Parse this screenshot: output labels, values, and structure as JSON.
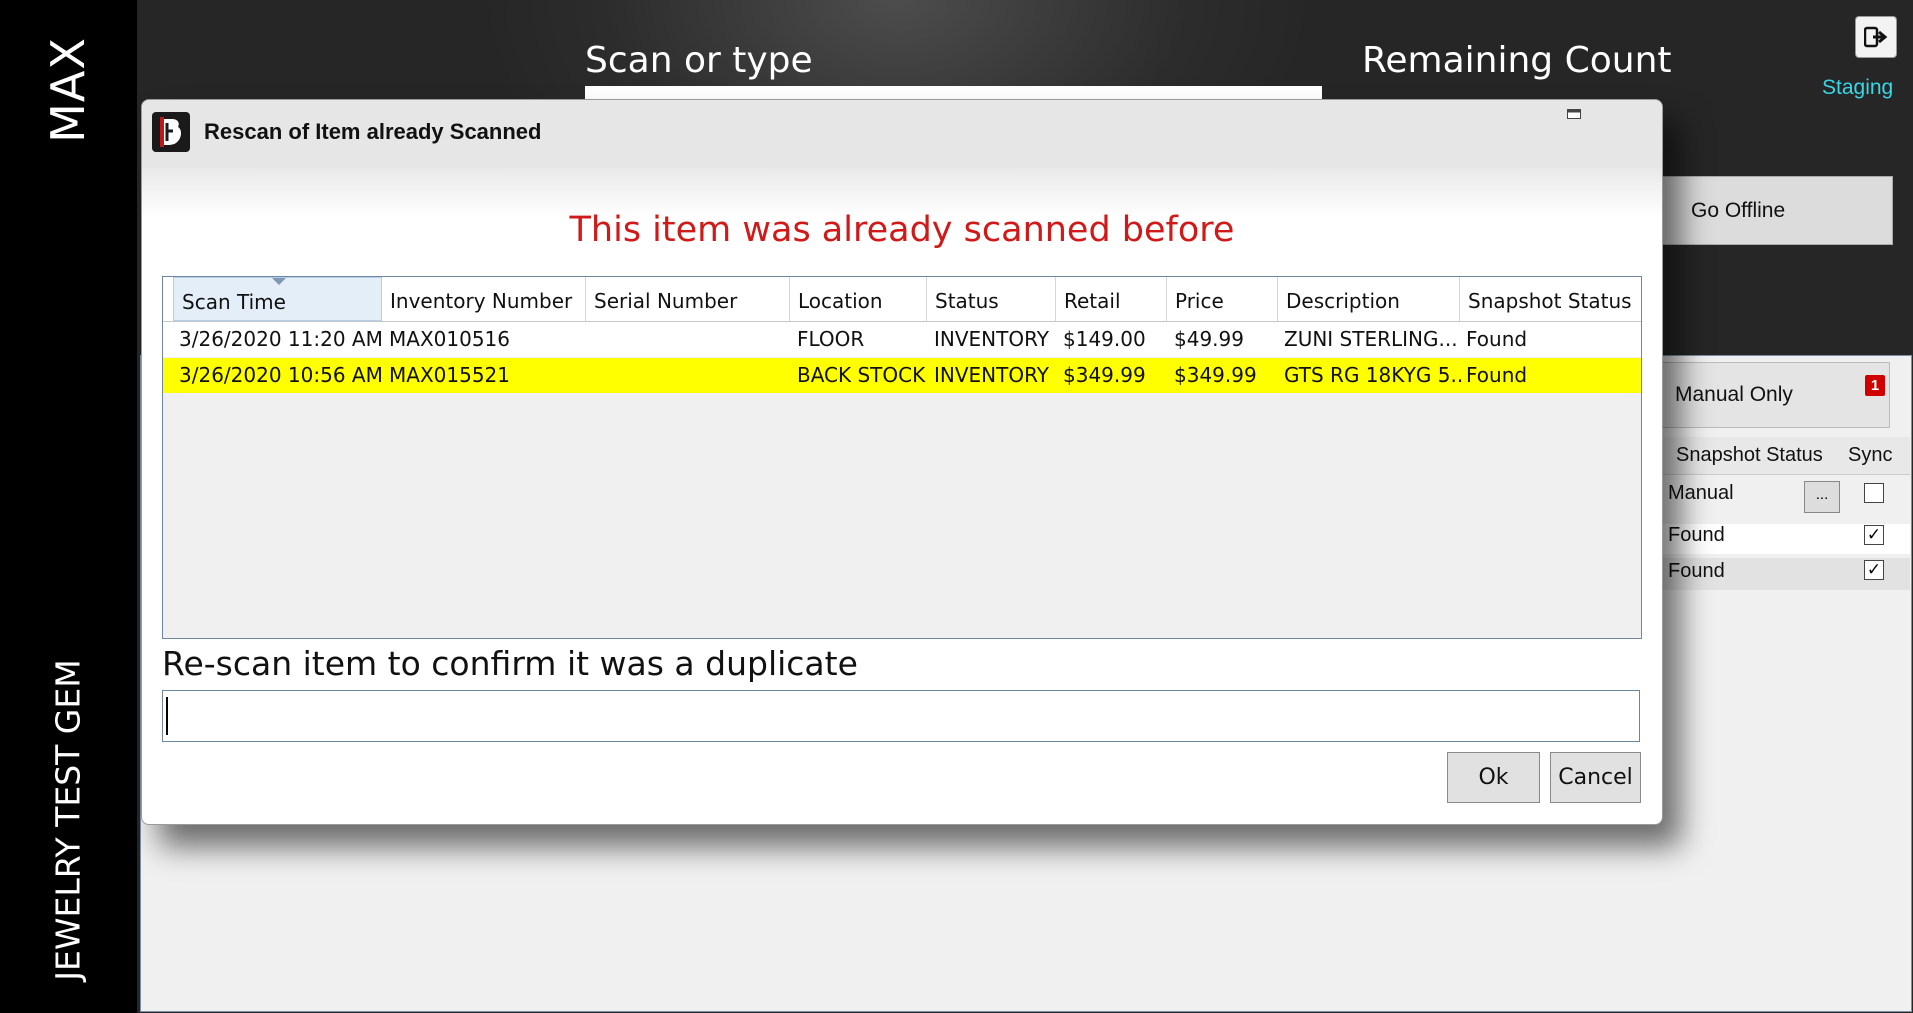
{
  "sidebar": {
    "store_name": "MAX",
    "company_name": "JEWELRY TEST GEM"
  },
  "background": {
    "scan_label": "Scan or type",
    "remaining_label": "Remaining Count",
    "staging_label": "Staging",
    "go_offline_label": "Go Offline",
    "manual_only_label": "Manual Only",
    "manual_only_badge": "1",
    "grid": {
      "headers": [
        "Snapshot Status",
        "Sync"
      ],
      "rows": [
        {
          "status": "Manual",
          "sync": false,
          "has_button": true,
          "button_label": "..."
        },
        {
          "status": "Found",
          "sync": true
        },
        {
          "status": "Found",
          "sync": true
        }
      ]
    },
    "exit_icon": "exit-icon"
  },
  "dialog": {
    "title": "Rescan of Item already Scanned",
    "headline": "This item was already scanned before",
    "headline_color": "#d01a1a",
    "table": {
      "columns": [
        "Scan Time",
        "Inventory Number",
        "Serial Number",
        "Location",
        "Status",
        "Retail",
        "Price",
        "Description",
        "Snapshot Status"
      ],
      "sorted_column": "Scan Time",
      "rows": [
        {
          "scan_time": "3/26/2020 11:20 AM",
          "inventory_number": "MAX010516",
          "serial_number": "",
          "location": "FLOOR",
          "status": "INVENTORY",
          "retail": "$149.00",
          "price": "$49.99",
          "description": "ZUNI STERLING...",
          "snapshot_status": "Found",
          "highlighted": false
        },
        {
          "scan_time": "3/26/2020 10:56 AM",
          "inventory_number": "MAX015521",
          "serial_number": "",
          "location": "BACK STOCK",
          "status": "INVENTORY",
          "retail": "$349.99",
          "price": "$349.99",
          "description": "GTS RG 18KYG 5...",
          "snapshot_status": "Found",
          "highlighted": true
        }
      ],
      "highlight_color": "#ffff00"
    },
    "confirm_label": "Re-scan item to confirm it was a duplicate",
    "confirm_value": "",
    "ok_label": "Ok",
    "cancel_label": "Cancel"
  }
}
